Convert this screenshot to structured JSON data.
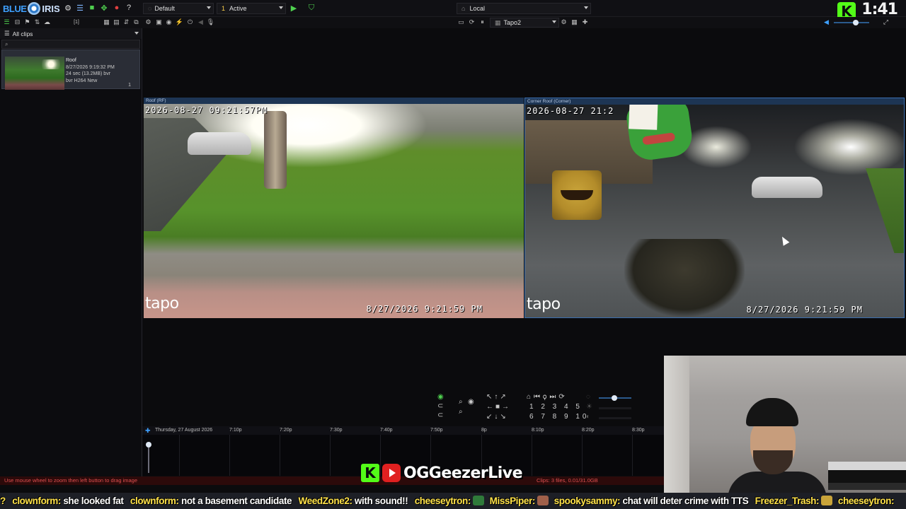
{
  "app": {
    "logo_blue": "BLUE",
    "logo_iris": "IRIS",
    "profile": "Default",
    "schedule_num": "1",
    "schedule": "Active",
    "connection": "Local",
    "clock": "1:41",
    "kick_badge": "K"
  },
  "toolbar2": {
    "counter": "[1]",
    "camera_select": "Tapo2"
  },
  "clips": {
    "header": "All clips",
    "search_placeholder": "",
    "items": [
      {
        "name": "Roof",
        "datetime": "8/27/2026 9:19:32 PM",
        "duration": "24 sec (13.2MB) bvr",
        "format": "bvr H264 New",
        "count": "1"
      }
    ]
  },
  "cameras": [
    {
      "title": "Roof (RF)",
      "osd_top": "2026-08-27 09:21:57PM",
      "osd_bottom": "8/27/2026 9:21:59 PM",
      "watermark": "tapo"
    },
    {
      "title": "Corner Roof (Corner)",
      "osd_top": "2026-08-27 21:2",
      "osd_bottom": "8/27/2026 9:21:59 PM",
      "watermark": "tapo"
    }
  ],
  "ptz": {
    "row1": "1 2 3 4 5",
    "row2": "6 7 8 9 10"
  },
  "timeline": {
    "date": "Thursday, 27 August 2026",
    "labels": [
      "7:10p",
      "7:20p",
      "7:30p",
      "7:40p",
      "7:50p",
      "8p",
      "8:10p",
      "8:20p",
      "8:30p"
    ]
  },
  "status": {
    "hint": "Use mouse wheel to zoom then left button to drag image",
    "clips_info": "Clips: 3 files, 0.01/31.0GB"
  },
  "overlay": {
    "channel": "OGGeezerLive",
    "kick": "K"
  },
  "chat": [
    {
      "user": "?",
      "msg": ""
    },
    {
      "user": "clownform:",
      "msg": "she looked fat"
    },
    {
      "user": "clownform:",
      "msg": "not a basement candidate"
    },
    {
      "user": "WeedZone2:",
      "msg": "with sound!!"
    },
    {
      "user": "cheeseytron:",
      "msg": ""
    },
    {
      "user": "MissPiper:",
      "msg": ""
    },
    {
      "user": "spookysammy:",
      "msg": "chat will deter crime with TTS"
    },
    {
      "user": "Freezer_Trash:",
      "msg": ""
    },
    {
      "user": "cheeseytron:",
      "msg": ""
    }
  ],
  "colors": {
    "accent": "#3ea0ff",
    "kick_green": "#53fc18",
    "status_red": "#e05050",
    "chat_user": "#ffe24a"
  }
}
